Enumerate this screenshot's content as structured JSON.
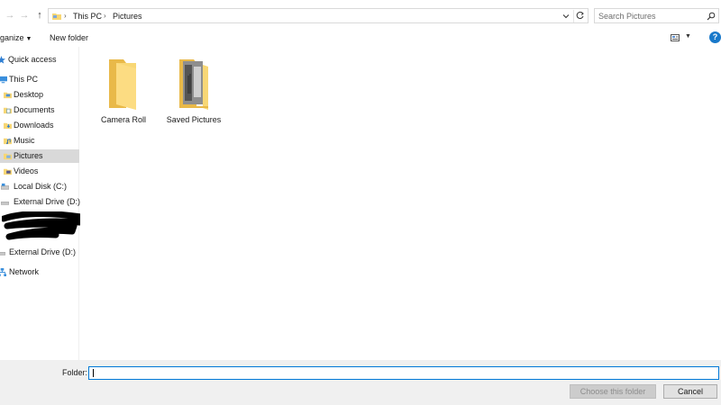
{
  "address_bar": {
    "breadcrumbs": [
      "This PC",
      "Pictures"
    ],
    "search_placeholder": "Search Pictures"
  },
  "toolbar": {
    "organize_label": "ganize",
    "new_folder_label": "New folder",
    "help_label": "?"
  },
  "nav_pane": {
    "items": [
      {
        "label": "Quick access",
        "icon": "star-icon"
      },
      {
        "label": "This PC",
        "icon": "computer-icon"
      },
      {
        "label": "Desktop",
        "icon": "desktop-folder-icon"
      },
      {
        "label": "Documents",
        "icon": "documents-folder-icon"
      },
      {
        "label": "Downloads",
        "icon": "downloads-folder-icon"
      },
      {
        "label": "Music",
        "icon": "music-folder-icon"
      },
      {
        "label": "Pictures",
        "icon": "pictures-folder-icon",
        "selected": true
      },
      {
        "label": "Videos",
        "icon": "videos-folder-icon"
      },
      {
        "label": "Local Disk (C:)",
        "icon": "drive-icon"
      },
      {
        "label": "External Drive (D:)",
        "icon": "drive-icon"
      },
      {
        "label": "External Drive (D:)",
        "icon": "drive-icon"
      },
      {
        "label": "Network",
        "icon": "network-icon"
      }
    ]
  },
  "content": {
    "folders": [
      {
        "name": "Camera Roll",
        "icon": "folder-icon"
      },
      {
        "name": "Saved Pictures",
        "icon": "folder-with-preview-icon"
      }
    ]
  },
  "footer": {
    "folder_label": "Folder:",
    "folder_value": "",
    "choose_button": "Choose this folder",
    "cancel_button": "Cancel"
  },
  "colors": {
    "accent": "#0078d7",
    "folder_yellow": "#f8d775",
    "selection": "#d9d9d9",
    "footer_bg": "#f0f0f0"
  }
}
